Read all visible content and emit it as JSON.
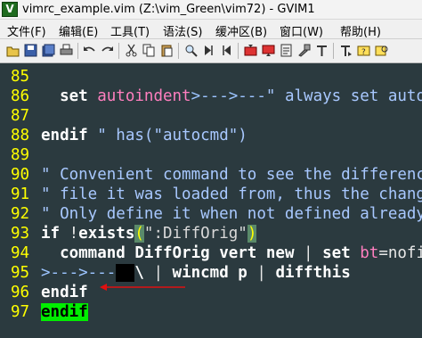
{
  "window": {
    "title": "vimrc_example.vim (Z:\\vim_Green\\vim72) - GVIM1",
    "icon": "vim-icon"
  },
  "menu": [
    "文件(F)",
    "编辑(E)",
    "工具(T)",
    "语法(S)",
    "缓冲区(B)",
    "窗口(W)",
    "帮助(H)"
  ],
  "toolbar": [
    "open-icon",
    "save-icon",
    "save-all-icon",
    "print-icon",
    "undo-icon",
    "redo-icon",
    "cut-icon",
    "copy-icon",
    "paste-icon",
    "find-replace-icon",
    "find-next-icon",
    "find-prev-icon",
    "load-session-icon",
    "save-session-icon",
    "run-script-icon",
    "make-icon",
    "ctags-icon",
    "jump-tag-icon",
    "help-icon",
    "find-help-icon"
  ],
  "editor": {
    "lines": [
      {
        "num": "85",
        "segments": []
      },
      {
        "num": "86",
        "segments": [
          [
            "plain",
            "  "
          ],
          [
            "kw",
            "set"
          ],
          [
            "plain",
            " "
          ],
          [
            "opt",
            "autoindent"
          ],
          [
            "tab",
            ">--->---"
          ],
          [
            "cmt",
            "\" always set auto"
          ]
        ]
      },
      {
        "num": "87",
        "segments": []
      },
      {
        "num": "88",
        "segments": [
          [
            "kw",
            "endif"
          ],
          [
            "plain",
            " "
          ],
          [
            "cmt",
            "\" has(\"autocmd\")"
          ]
        ]
      },
      {
        "num": "89",
        "segments": []
      },
      {
        "num": "90",
        "segments": [
          [
            "cmt",
            "\" Convenient command to see the differenc"
          ]
        ]
      },
      {
        "num": "91",
        "segments": [
          [
            "cmt",
            "\" file it was loaded from, thus the chang"
          ]
        ]
      },
      {
        "num": "92",
        "segments": [
          [
            "cmt",
            "\" Only define it when not defined already"
          ]
        ]
      },
      {
        "num": "93",
        "segments": [
          [
            "kw",
            "if"
          ],
          [
            "plain",
            " !"
          ],
          [
            "kw",
            "exists"
          ],
          [
            "paren-hl",
            "("
          ],
          [
            "str",
            "\":DiffOrig\""
          ],
          [
            "paren-hl",
            ")"
          ]
        ]
      },
      {
        "num": "94",
        "segments": [
          [
            "plain",
            "  "
          ],
          [
            "kw",
            "command DiffOrig vert new"
          ],
          [
            "plain",
            " | "
          ],
          [
            "kw",
            "set"
          ],
          [
            "plain",
            " "
          ],
          [
            "opt",
            "bt"
          ],
          [
            "plain",
            "=nofi"
          ]
        ]
      },
      {
        "num": "95",
        "segments": [
          [
            "tab",
            ">--->---"
          ],
          [
            "blackbox",
            "  "
          ],
          [
            "kw",
            "\\"
          ],
          [
            "plain",
            " | "
          ],
          [
            "kw",
            "wincmd p"
          ],
          [
            "plain",
            " | "
          ],
          [
            "kw",
            "diffthis"
          ]
        ]
      },
      {
        "num": "96",
        "segments": [
          [
            "kw",
            "endif"
          ]
        ]
      },
      {
        "num": "97",
        "segments": [
          [
            "cursor-word",
            "endif"
          ]
        ]
      }
    ]
  },
  "colors": {
    "background": "#2b3a3f",
    "line_numbers": "#ffff00",
    "keyword": "#ffffff",
    "comment": "#a8c8ff",
    "option": "#ff7fbf",
    "cursor_word": "#00ee00",
    "annotation_arrow": "#e01010"
  }
}
